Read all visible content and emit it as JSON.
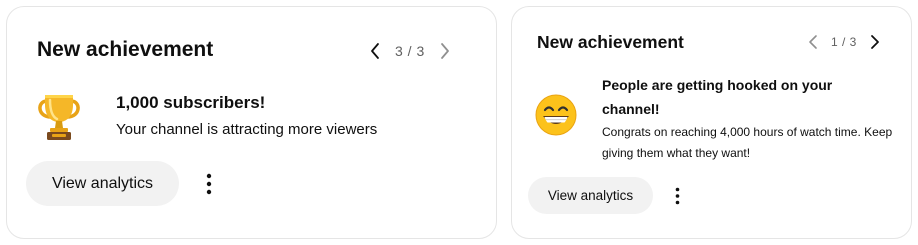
{
  "cards": [
    {
      "title": "New achievement",
      "page_indicator": "3 / 3",
      "emoji": "trophy-icon",
      "achievement_title": "1,000 subscribers!",
      "achievement_desc": "Your channel is attracting more viewers",
      "button_label": "View analytics"
    },
    {
      "title": "New achievement",
      "page_indicator": "1 / 3",
      "emoji": "grinning-face-icon",
      "achievement_title": "People are getting hooked on your channel!",
      "achievement_desc": "Congrats on reaching 4,000 hours of watch time. Keep giving them what they want!",
      "button_label": "View analytics"
    }
  ],
  "colors": {
    "card_border": "#e5e5e5",
    "button_bg": "#f2f2f2",
    "text_primary": "#0f0f0f",
    "text_secondary": "#606060",
    "chevron_disabled": "#909090",
    "chevron_enabled": "#0f0f0f"
  }
}
